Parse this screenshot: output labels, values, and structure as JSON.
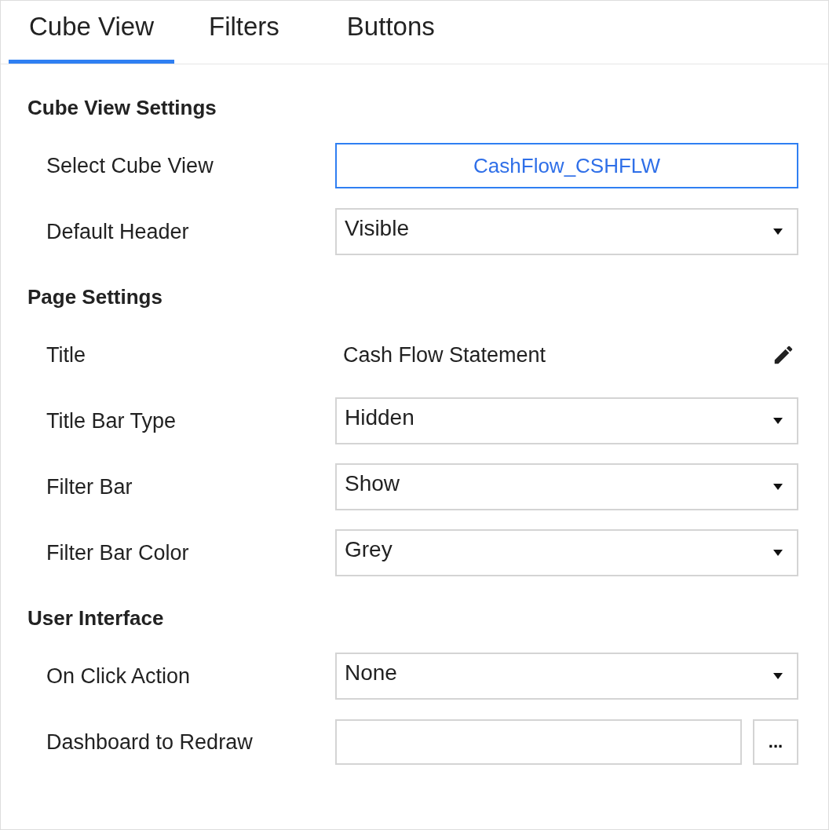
{
  "tabs": [
    {
      "label": "Cube View",
      "selected": true
    },
    {
      "label": "Filters",
      "selected": false
    },
    {
      "label": "Buttons",
      "selected": false
    }
  ],
  "sections": [
    {
      "heading": "Cube View Settings",
      "rows": [
        {
          "label": "Select Cube View",
          "kind": "button",
          "value": "CashFlow_CSHFLW"
        },
        {
          "label": "Default Header",
          "kind": "select",
          "value": "Visible"
        }
      ]
    },
    {
      "heading": "Page Settings",
      "rows": [
        {
          "label": "Title",
          "kind": "text",
          "value": "Cash Flow Statement"
        },
        {
          "label": "Title Bar Type",
          "kind": "select",
          "value": "Hidden"
        },
        {
          "label": "Filter Bar",
          "kind": "select",
          "value": "Show"
        },
        {
          "label": "Filter Bar Color",
          "kind": "select",
          "value": "Grey"
        }
      ]
    },
    {
      "heading": "User Interface",
      "rows": [
        {
          "label": "On Click Action",
          "kind": "select",
          "value": "None"
        },
        {
          "label": "Dashboard to Redraw",
          "kind": "field_button",
          "button": "..."
        }
      ]
    }
  ]
}
